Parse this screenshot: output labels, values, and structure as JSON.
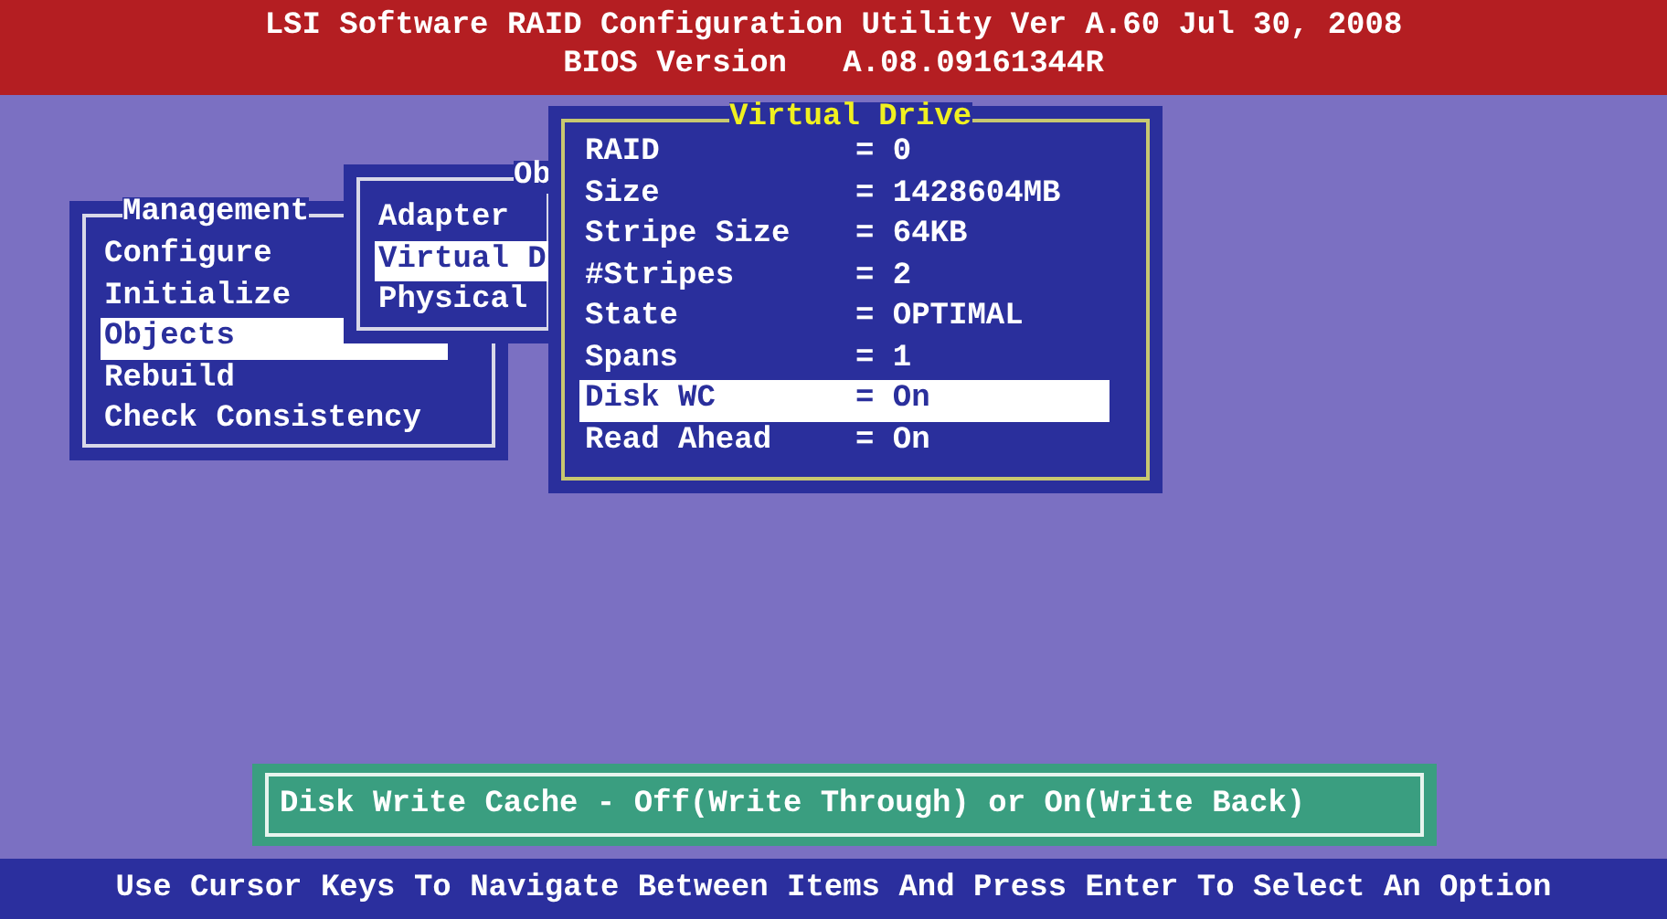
{
  "header": {
    "title": "LSI Software RAID Configuration Utility Ver A.60 Jul 30, 2008",
    "subtitle": "BIOS Version   A.08.09161344R"
  },
  "management": {
    "title": "Management",
    "items": [
      {
        "label": "Configure",
        "selected": false
      },
      {
        "label": "Initialize",
        "selected": false
      },
      {
        "label": "Objects",
        "selected": true
      },
      {
        "label": "Rebuild",
        "selected": false
      },
      {
        "label": "Check Consistency",
        "selected": false
      }
    ]
  },
  "objects": {
    "title": "Ob",
    "items": [
      {
        "label": "Adapter",
        "selected": false
      },
      {
        "label": "Virtual D",
        "selected": true
      },
      {
        "label": "Physical",
        "selected": false
      }
    ]
  },
  "virtual_drive": {
    "title": "Virtual Drive",
    "rows": [
      {
        "label": "RAID",
        "value": "= 0",
        "selected": false
      },
      {
        "label": "Size",
        "value": "= 1428604MB",
        "selected": false
      },
      {
        "label": "Stripe Size",
        "value": "= 64KB",
        "selected": false
      },
      {
        "label": "#Stripes",
        "value": "= 2",
        "selected": false
      },
      {
        "label": "State",
        "value": "= OPTIMAL",
        "selected": false
      },
      {
        "label": "Spans",
        "value": "= 1",
        "selected": false
      },
      {
        "label": "Disk WC",
        "value": "= On",
        "selected": true
      },
      {
        "label": "Read Ahead",
        "value": "= On",
        "selected": false
      }
    ]
  },
  "help": "Disk Write Cache - Off(Write Through) or On(Write Back)",
  "status_bar": "Use Cursor Keys To Navigate Between Items And Press Enter To Select An Option"
}
